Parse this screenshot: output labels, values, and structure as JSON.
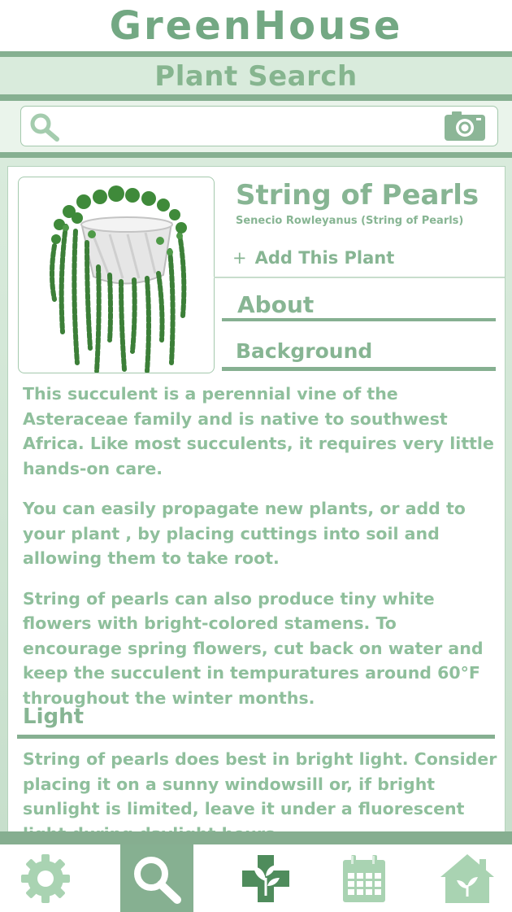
{
  "app": {
    "logo_text": "GreenHouse",
    "screen_title": "Plant Search"
  },
  "search": {
    "value": "",
    "placeholder": ""
  },
  "plant": {
    "name": "String of Pearls",
    "scientific_name": "Senecio Rowleyanus (String of Pearls)",
    "add_label": "Add This Plant",
    "add_symbol": "+"
  },
  "sections": {
    "about": "About",
    "background": "Background",
    "light": "Light"
  },
  "background_paragraphs": [
    "This succulent is a perennial vine of the Asteraceae family and is native to southwest Africa. Like most succulents, it requires very little hands-on care.",
    "You can easily propagate new plants, or add to your plant , by placing cuttings into soil and allowing them to take root.",
    "String of pearls can also produce tiny white flowers with bright-colored stamens. To encourage spring flowers, cut back on water and keep the succulent in tempuratures around 60°F throughout the winter months."
  ],
  "light_text": "String of pearls does best in bright light. Consider placing it on a sunny windowsill or, if bright sunlight is limited, leave it under a fluorescent light during daylight hours.",
  "nav": {
    "items": [
      {
        "icon": "gear-icon",
        "active": false
      },
      {
        "icon": "search-icon",
        "active": true
      },
      {
        "icon": "plant-care-icon",
        "active": false
      },
      {
        "icon": "calendar-icon",
        "active": false
      },
      {
        "icon": "home-icon",
        "active": false
      }
    ]
  },
  "colors": {
    "accent": "#86b091",
    "text": "#8fbf9c",
    "band": "#d9ebdc"
  }
}
